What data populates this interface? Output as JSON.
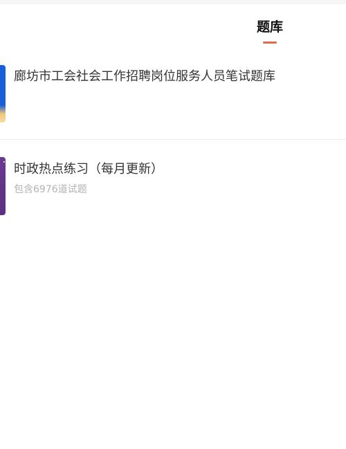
{
  "tabs": {
    "active_label": "题库",
    "accent_color": "#e46a45"
  },
  "items": [
    {
      "title": "廊坊市工会社会工作招聘岗位服务人员笔试题库",
      "subtitle": ""
    },
    {
      "title": "时政热点练习（每月更新）",
      "subtitle": "包含6976道试题"
    }
  ]
}
